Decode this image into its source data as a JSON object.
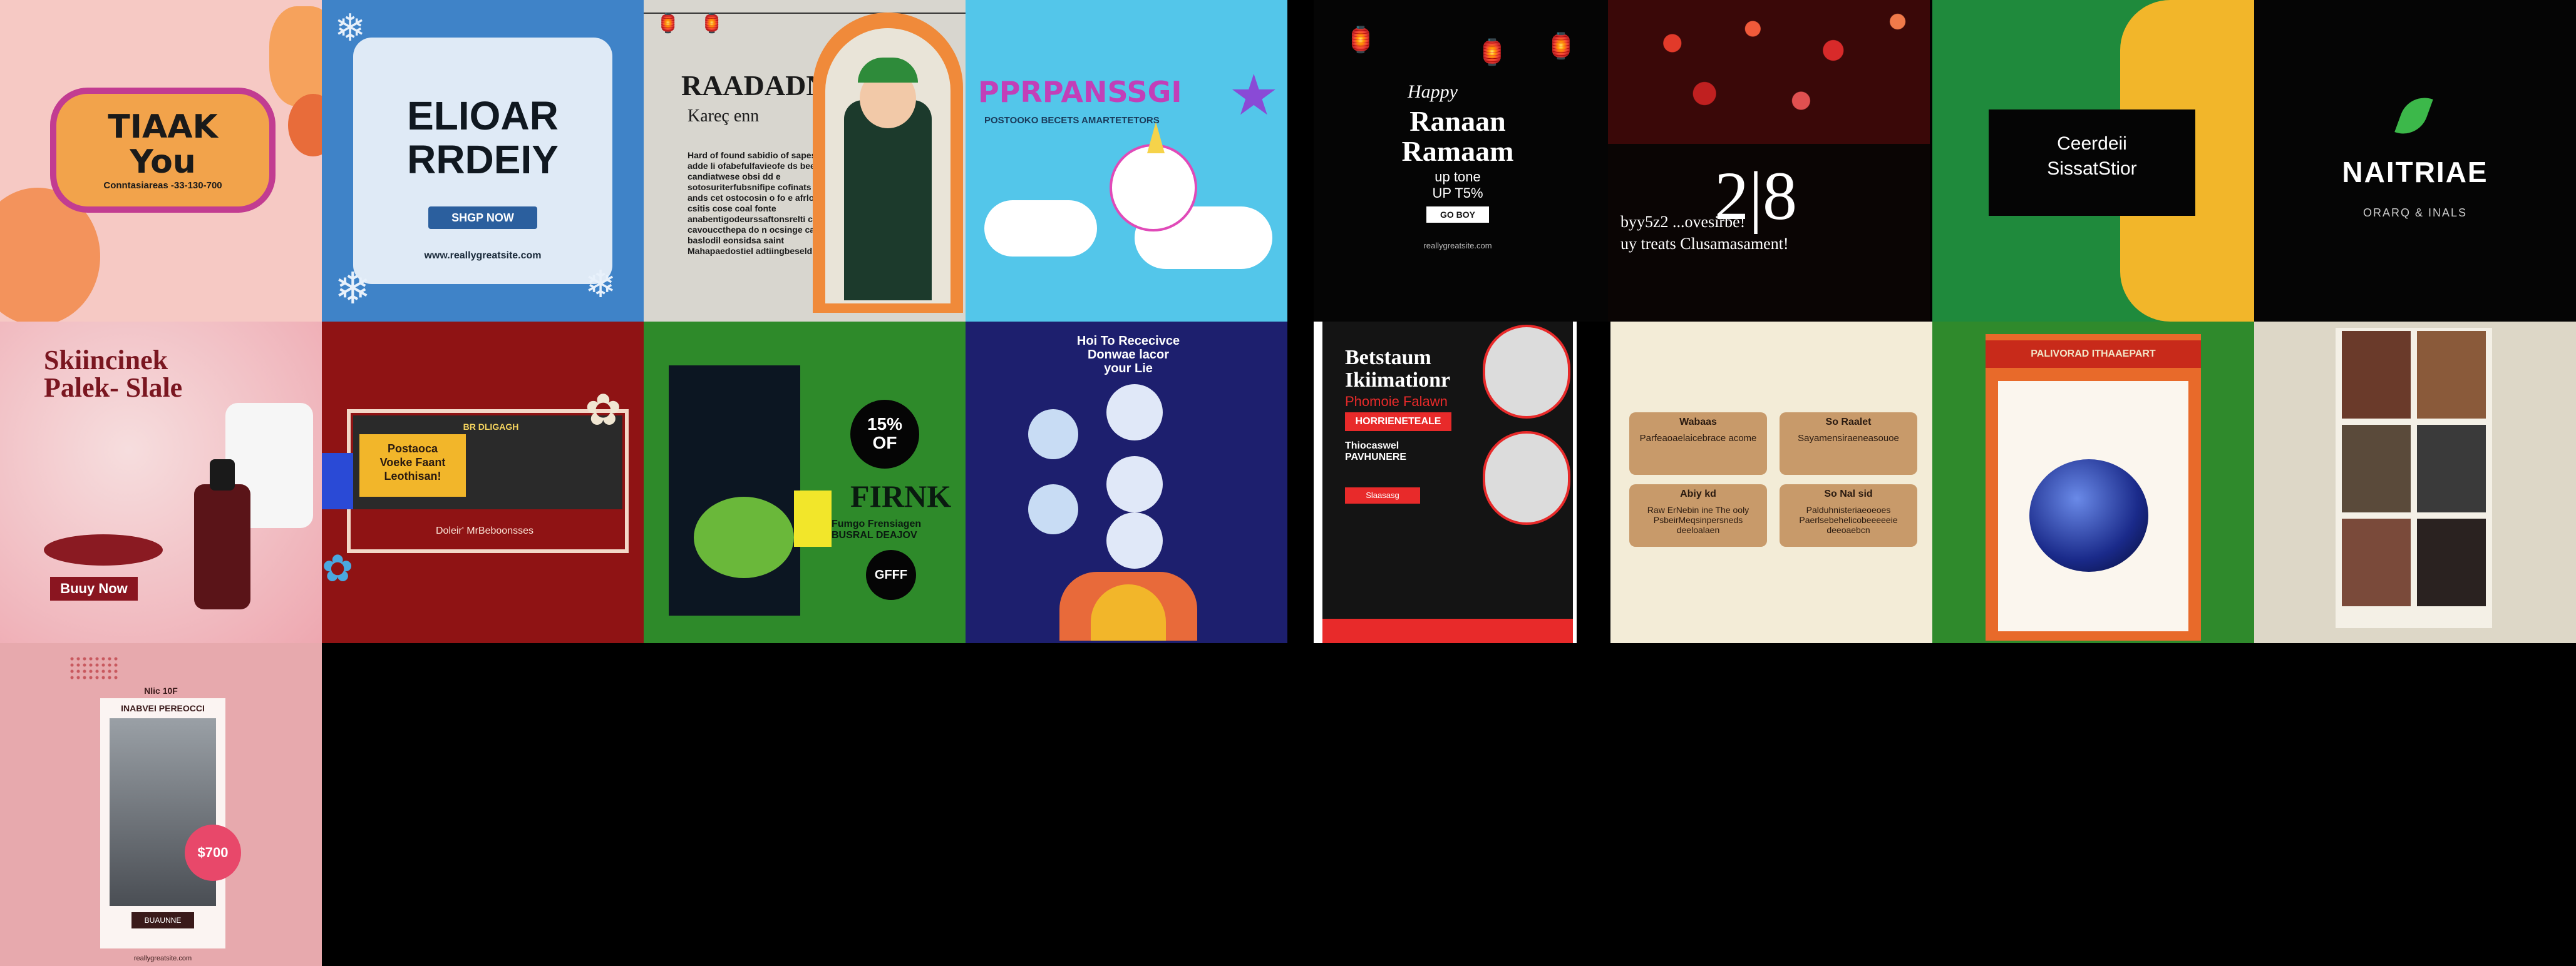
{
  "grid": {
    "t1": {
      "title": "TIAAK\nYou",
      "sub": "Conntasiareas -33-130-700",
      "bg": "#f6c9c4"
    },
    "t2": {
      "title": "ELIOAR\nRRDEIY",
      "button": "SHGP NOW",
      "url": "www.reallygreatsite.com",
      "bg": "#3f83c8"
    },
    "t3": {
      "title": "RAADADN",
      "subtitle": "Kareç enn",
      "body": "Hard of found sabidio of sapes ofde adde li ofabefulfavieofe ds beed est candiatwese obsi dd e sotosuriterfubsnifipe cofinats erccu ands cet ostocosin o fo e afrlonbeid csitis cose coal fonte anabentigodeurssaftonsrelti codes cavouccthepa do n ocsinge calavtiy baslodil eonsidsa saint Mahapaedostiel adtiingbeseld",
      "bg": "#d8d6cf"
    },
    "t4": {
      "title": "PPRPANSSGI",
      "sub": "POSTOOKO BECETS AMARTETETORS",
      "bg": "#53c6ea"
    },
    "t5": {
      "greeting": "Happy",
      "title": "Ranaan\nRamaam",
      "offer": "up tone\nUP T5%",
      "button": "GO BOY",
      "url": "reallygreatsite.com",
      "bg": "#050505"
    },
    "t6": {
      "big": "2|8",
      "line1": "byy5z2 ...ovesirbe!",
      "line2": "uy treats Clusamasament!",
      "bg": "#0a0504"
    },
    "t7": {
      "title": "Ceerdeii\nSissatStior",
      "bg": "#1f8a3c"
    },
    "t8": {
      "title": "NAITRIAE",
      "sub": "ORARQ & INALS",
      "bg": "#050505"
    },
    "t9": {
      "title": "Skiincinek\nPalek- Slale",
      "button": "Buuy Now",
      "bg": "#f4d5d6"
    },
    "t10": {
      "label": "BR DLIGAGH",
      "card": "Postaoca\nVoeke Faant\nLeothisan!",
      "footer": "Doleir' MrBeboonsses",
      "bg": "#8f1314"
    },
    "t11": {
      "badge": "15%\nOF",
      "title": "FIRNK",
      "sub": "Fumgo Frensiagen\nBUSRAL DEAJOV",
      "button": "GFFF",
      "bg": "#2e8a2a"
    },
    "t12": {
      "title": "Hoi To Rececivce\nDonwae lacor\nyour Lie",
      "bg": "#1d1f6e"
    },
    "t13": {
      "title": "Betstaum\nIkiimationr",
      "sub": "Phomoie Falawn",
      "tag": "HORRIENETEALE",
      "line": "Thiocaswel\nPAVHUNERE",
      "button": "Slaasasg",
      "bg": "#ffffff"
    },
    "t14": {
      "cards": [
        {
          "title": "Wabaas",
          "body": "Parfeaoaelaicebrace acome"
        },
        {
          "title": "So Raalet",
          "body": "Sayamensiraeneasouoe"
        },
        {
          "title": "Abiy kd",
          "body": "Raw ErNebin ine The ooly PsbeirMeqsinpersneds deeloalaen"
        },
        {
          "title": "So Nal sid",
          "body": "Palduhnisteriaeoeoes Paerlsebehelicobeeeeeie deeoaebcn"
        }
      ],
      "bg": "#f3ecd7"
    },
    "t15": {
      "title": "PALIVORAD ITHAAEPART",
      "bg": "#2f8a2c"
    },
    "t16": {
      "bg": "#ddd7c7"
    },
    "t17": {
      "top": "Nlic 10F",
      "title": "INABVEI PEREOCCI",
      "price": "$700",
      "button": "BUAUNNE",
      "url": "reallygreatsite.com",
      "bg": "#e7a9ad"
    }
  }
}
